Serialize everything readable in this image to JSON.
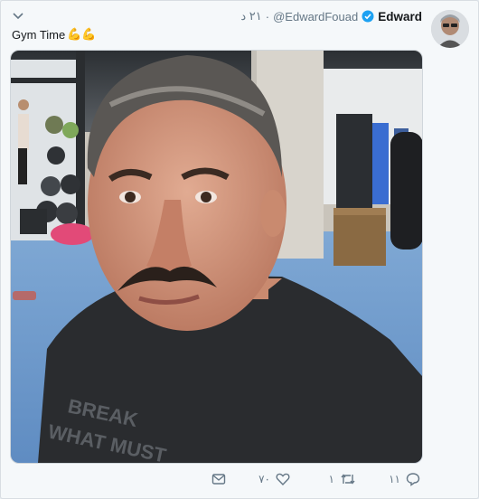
{
  "tweet": {
    "author_name": "Edward",
    "author_handle": "@EdwardFouad",
    "separator": "·",
    "timestamp": "٢١ د",
    "text": "Gym Time",
    "emoji": "💪💪"
  },
  "actions": {
    "replies": "١١",
    "retweets": "١",
    "likes": "٧٠"
  },
  "icons": {
    "caret": "chevron-down-icon",
    "verified": "verified-badge-icon",
    "reply": "reply-icon",
    "retweet": "retweet-icon",
    "like": "heart-icon",
    "dm": "envelope-icon"
  },
  "colors": {
    "verified_blue": "#1da1f2",
    "muted_text": "#657786",
    "card_bg": "#f5f8fa"
  }
}
